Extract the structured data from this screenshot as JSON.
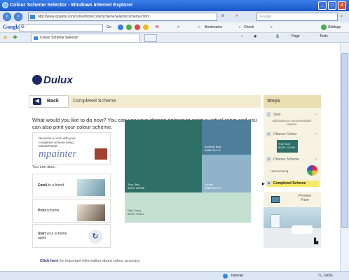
{
  "window": {
    "title": "Colour Scheme Selector - Windows Internet Explorer"
  },
  "addressbar": {
    "url": "http://www.icpaints.com/colourtools/ColorSchemeSelector/schemer.html",
    "search_placeholder": "Google"
  },
  "google_toolbar": {
    "logo": "Google",
    "search_value": "G-",
    "go_label": "Go",
    "bookmarks_label": "Bookmarks",
    "check_label": "Check",
    "more_label": "»",
    "settings_label": "Settings"
  },
  "tabs": [
    {
      "label": "Colour Scheme Selector"
    }
  ],
  "ie_toolbar": {
    "page_label": "Page",
    "tools_label": "Tools"
  },
  "page": {
    "brand": "Dulux",
    "back_label": "Back",
    "section_title": "Completed Scheme",
    "question": "What would you like to do now? You can use your chosen colours to paint a virtual room and you can also print your colour scheme.",
    "mousepainter_text": "Decorate a room with your completed scheme using MousePainter",
    "mousepainter_logo": "mpainter",
    "also_label": "You can also...",
    "actions": [
      {
        "bold": "Email",
        "rest": " to a friend"
      },
      {
        "bold": "Print",
        "rest": " scheme"
      },
      {
        "bold": "Start",
        "rest": " your scheme again"
      }
    ],
    "click_here_bold": "Click here",
    "click_here_rest": " for important information about colour accuracy",
    "swatches": [
      {
        "name": "True Teal",
        "code": "90GG 12/206",
        "color": "#2e7067"
      },
      {
        "name": "Bombay Blue",
        "code": "30BB 22/141",
        "color": "#4d7e9a"
      },
      {
        "name": "Jordan",
        "code": "30BB 50/107",
        "color": "#8fb4c9"
      },
      {
        "name": "Rain Song",
        "code": "30GG 75/111",
        "color": "#c4e0d1"
      }
    ]
  },
  "steps": {
    "heading": "Steps",
    "items": [
      {
        "num": "1",
        "label": "Start"
      },
      {
        "num": "2",
        "label": "Choose Colour"
      },
      {
        "num": "3",
        "label": "Choose Scheme"
      },
      {
        "num": "4",
        "label": "Completed Scheme"
      }
    ],
    "add_dulux": "Add Dulux to recommended colours",
    "chip_name": "True Teal",
    "chip_code": "90GG 12/206",
    "harmonising": "Harmonising",
    "preview_label": "Preview Pane"
  },
  "statusbar": {
    "zone": "Internet",
    "zoom": "100%"
  }
}
